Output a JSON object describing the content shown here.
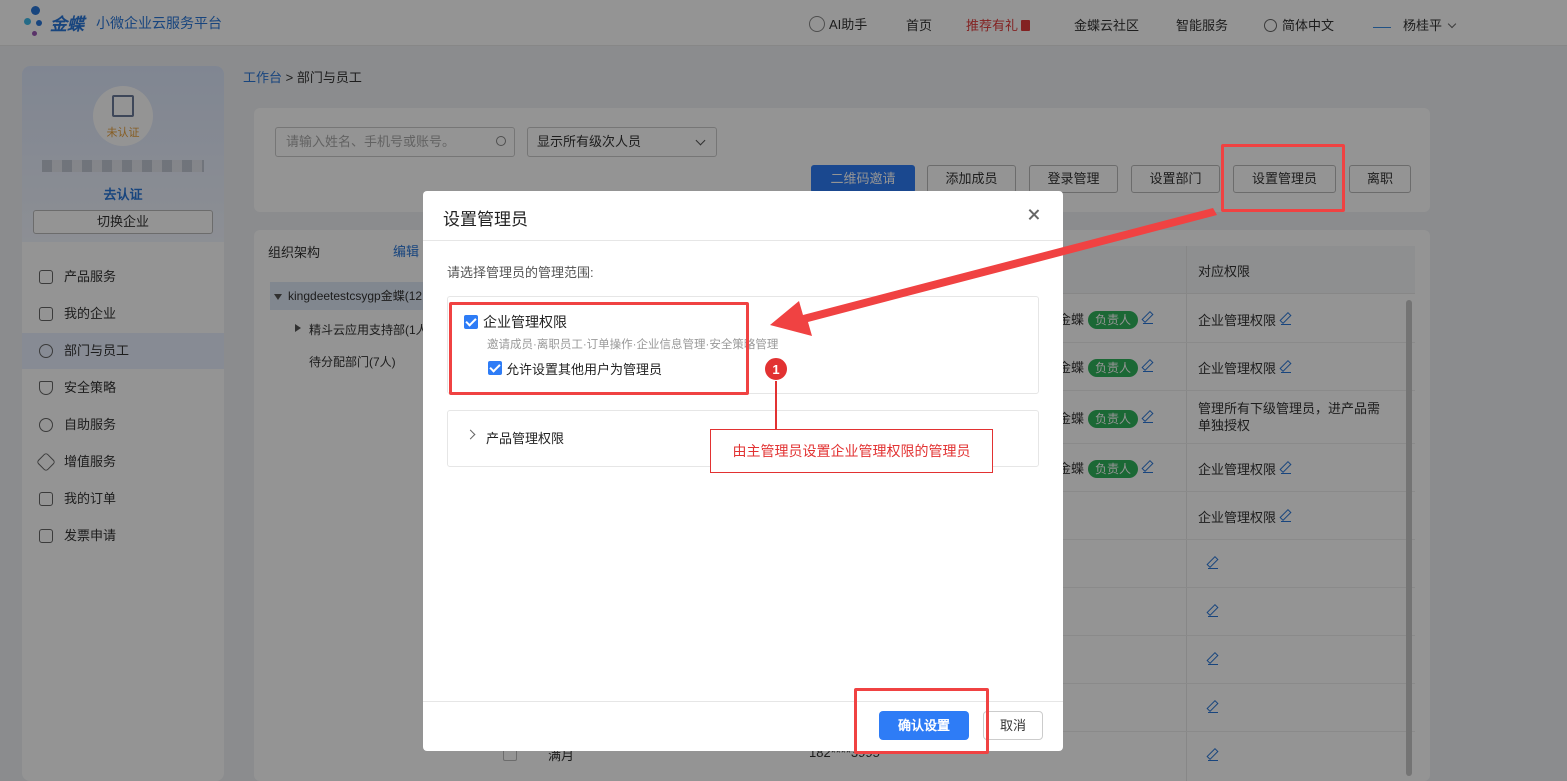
{
  "topbar": {
    "brand": "金蝶",
    "platform": "小微企业云服务平台",
    "ai": "AI助手",
    "home": "首页",
    "promo": "推荐有礼",
    "community": "金蝶云社区",
    "service": "智能服务",
    "language": "简体中文",
    "user": "杨桂平"
  },
  "sidebar": {
    "status": "未认证",
    "verify": "去认证",
    "switch": "切换企业",
    "items": [
      "产品服务",
      "我的企业",
      "部门与员工",
      "安全策略",
      "自助服务",
      "增值服务",
      "我的订单",
      "发票申请"
    ],
    "active_index": 2
  },
  "breadcrumb": {
    "root": "工作台",
    "sep": " > ",
    "current": "部门与员工"
  },
  "filters": {
    "search_placeholder": "请输入姓名、手机号或账号。",
    "level_select": "显示所有级次人员"
  },
  "toolbar": {
    "qr_invite": "二维码邀请",
    "add_member": "添加成员",
    "login_mgmt": "登录管理",
    "set_dept": "设置部门",
    "set_admin": "设置管理员",
    "resign": "离职"
  },
  "org": {
    "title": "组织架构",
    "edit": "编辑",
    "root": "kingdeetestcsygp金蝶(12",
    "child1": "精斗云应用支持部(1人",
    "child2": "待分配部门(7人)"
  },
  "table": {
    "perm_header": "对应权限",
    "rows": [
      {
        "name": "金蝶",
        "badge": "负责人",
        "perm": "企业管理权限"
      },
      {
        "name": "金蝶",
        "badge": "负责人",
        "perm": "企业管理权限"
      },
      {
        "name": "金蝶",
        "badge": "负责人",
        "perm": "管理所有下级管理员，进产品需",
        "perm2": "单独授权"
      },
      {
        "name": "金蝶",
        "badge": "负责人",
        "perm": "企业管理权限"
      },
      {
        "name": "",
        "badge": "",
        "perm": "企业管理权限"
      }
    ],
    "last_row_name": "满月",
    "last_row_phone": "182****3995"
  },
  "modal": {
    "title": "设置管理员",
    "scope_label": "请选择管理员的管理范围:",
    "enterprise_perm": "企业管理权限",
    "enterprise_desc": "邀请成员·离职员工·订单操作·企业信息管理·安全策略管理",
    "allow_other": "允许设置其他用户为管理员",
    "product_perm": "产品管理权限",
    "confirm": "确认设置",
    "cancel": "取消"
  },
  "annotation": {
    "number": "1",
    "text": "由主管理员设置企业管理权限的管理员"
  },
  "colors": {
    "primary": "#2e7cf6",
    "annotation": "#e23232",
    "badge": "#2fb35c"
  }
}
